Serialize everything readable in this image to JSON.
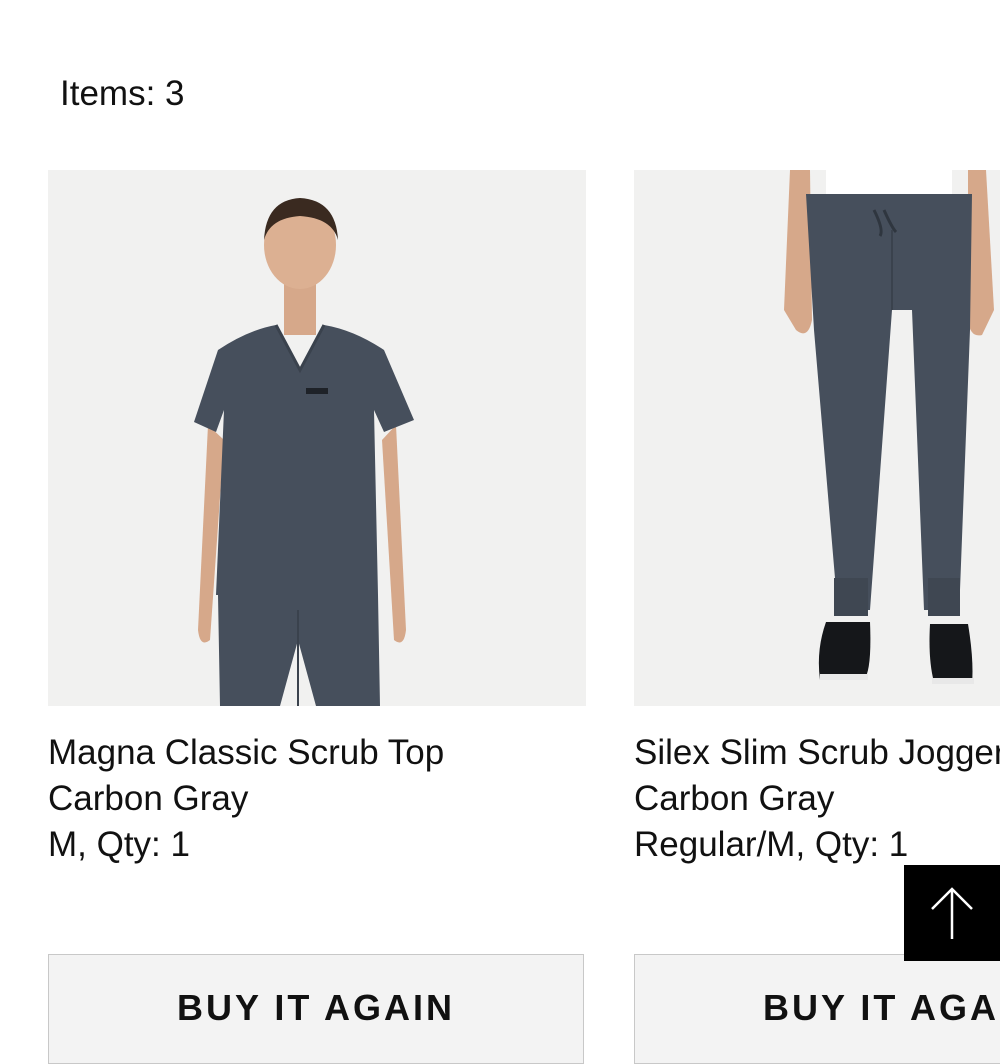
{
  "items_label": "Items: 3",
  "products": [
    {
      "name": "Magna Classic Scrub Top",
      "color": "Carbon Gray",
      "details": "M, Qty: 1",
      "button": "BUY IT AGAIN"
    },
    {
      "name": "Silex Slim Scrub Joggers",
      "color": "Carbon Gray",
      "details": "Regular/M, Qty: 1",
      "button": "BUY IT AGAIN"
    }
  ],
  "scroll_top_icon": "arrow-up-icon",
  "colors": {
    "scrub": "#464f5c",
    "photo_bg": "#f1f1f0",
    "button_bg": "#f3f3f3"
  }
}
